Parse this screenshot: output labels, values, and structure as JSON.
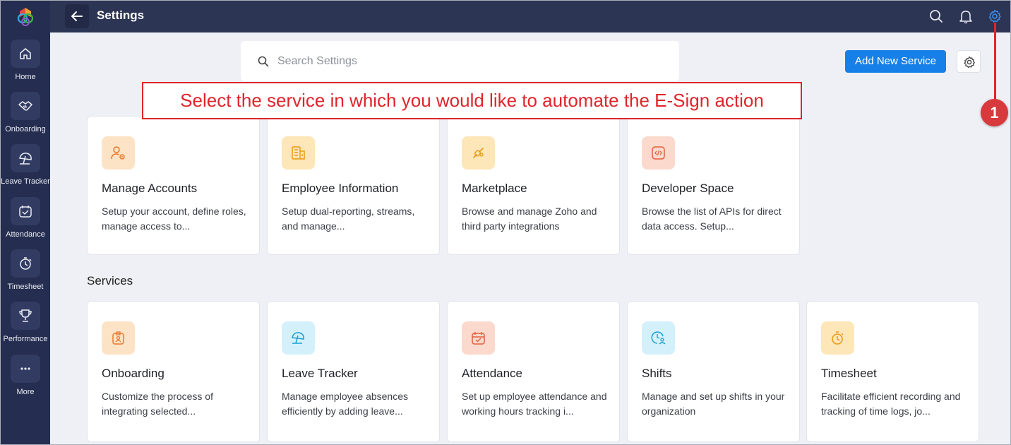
{
  "app": {
    "title": "Settings"
  },
  "sidebar": {
    "items": [
      {
        "label": "Home",
        "icon": "home-icon"
      },
      {
        "label": "Onboarding",
        "icon": "handshake-icon"
      },
      {
        "label": "Leave Tracker",
        "icon": "umbrella-icon"
      },
      {
        "label": "Attendance",
        "icon": "calendar-check-icon"
      },
      {
        "label": "Timesheet",
        "icon": "timer-icon"
      },
      {
        "label": "Performance",
        "icon": "trophy-icon"
      },
      {
        "label": "More",
        "icon": "more-icon"
      }
    ]
  },
  "search": {
    "placeholder": "Search Settings"
  },
  "toolbar": {
    "add_label": "Add New Service"
  },
  "callout": {
    "text": "Select the service in which you would like to automate the E-Sign action",
    "marker": "1"
  },
  "top_cards": [
    {
      "title": "Manage Accounts",
      "desc": "Setup your account, define roles, manage access to...",
      "icon": "user-settings-icon"
    },
    {
      "title": "Employee Information",
      "desc": "Setup dual-reporting, streams, and manage...",
      "icon": "building-icon"
    },
    {
      "title": "Marketplace",
      "desc": "Browse and manage Zoho and third party integrations",
      "icon": "plug-icon"
    },
    {
      "title": "Developer Space",
      "desc": "Browse the list of APIs for direct data access. Setup...",
      "icon": "code-icon"
    }
  ],
  "services": {
    "title": "Services",
    "cards": [
      {
        "title": "Onboarding",
        "desc": "Customize the process of integrating selected...",
        "icon": "badge-icon"
      },
      {
        "title": "Leave Tracker",
        "desc": "Manage employee absences efficiently by adding leave...",
        "icon": "umbrella-icon"
      },
      {
        "title": "Attendance",
        "desc": "Set up employee attendance and working hours tracking i...",
        "icon": "calendar-check-icon"
      },
      {
        "title": "Shifts",
        "desc": "Manage and set up shifts in your organization",
        "icon": "clock-user-icon"
      },
      {
        "title": "Timesheet",
        "desc": "Facilitate efficient recording and tracking of time logs, jo...",
        "icon": "timer-icon"
      }
    ]
  },
  "colors": {
    "sidebar_bg": "#252e50",
    "topbar_bg": "#2d3555",
    "accent_blue": "#1780e8",
    "annotation_red": "#e0242b"
  }
}
